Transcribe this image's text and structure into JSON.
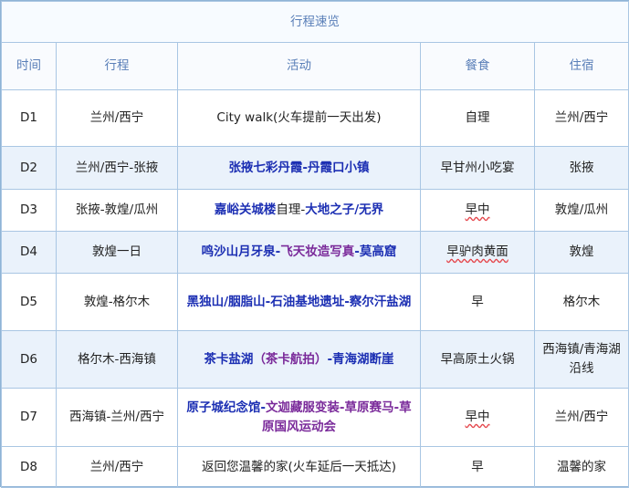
{
  "title": "行程速览",
  "headers": [
    "时间",
    "行程",
    "活动",
    "餐食",
    "住宿"
  ],
  "rows": [
    {
      "day": "D1",
      "route": "兰州/西宁",
      "activity": "City walk(火车提前一天出发)",
      "meals": "自理",
      "stay": "兰州/西宁"
    },
    {
      "day": "D2",
      "route": "兰州/西宁-张掖",
      "activity": "张掖七彩丹霞-丹霞口小镇",
      "meals": "早甘州小吃宴",
      "stay": "张掖"
    },
    {
      "day": "D3",
      "route": "张掖-敦煌/瓜州",
      "activity_parts": [
        "嘉峪关城楼",
        "自理-",
        "大地之子/无界"
      ],
      "meals": "早中",
      "stay": "敦煌/瓜州"
    },
    {
      "day": "D4",
      "route": "敦煌一日",
      "activity_parts": [
        "鸣沙山月牙泉-",
        "飞天妆造写真",
        "-莫高窟"
      ],
      "meals": "早驴肉黄面",
      "stay": "敦煌"
    },
    {
      "day": "D5",
      "route": "敦煌-格尔木",
      "activity": "黑独山/胭脂山-石油基地遗址-察尔汗盐湖",
      "meals": "早",
      "stay": "格尔木"
    },
    {
      "day": "D6",
      "route": "格尔木-西海镇",
      "activity_parts": [
        "茶卡盐湖",
        "（茶卡航拍）",
        "-青海湖断崖"
      ],
      "meals": "早高原土火锅",
      "stay": "西海镇/青海湖沿线"
    },
    {
      "day": "D7",
      "route": "西海镇-兰州/西宁",
      "activity_parts": [
        "原子城纪念馆-",
        "文迦藏服变装-草原赛马-草原国风运动会"
      ],
      "meals": "早中",
      "stay": "兰州/西宁"
    },
    {
      "day": "D8",
      "route": "兰州/西宁",
      "activity": "返回您温馨的家(火车延后一天抵达)",
      "meals": "早",
      "stay": "温馨的家"
    }
  ],
  "colors": {
    "border": "#a9c6e3",
    "header_text": "#5a7fb8",
    "row_shade": "#eaf2fb",
    "activity_blue": "#1c2fb3",
    "activity_purple": "#7a2a9a"
  }
}
